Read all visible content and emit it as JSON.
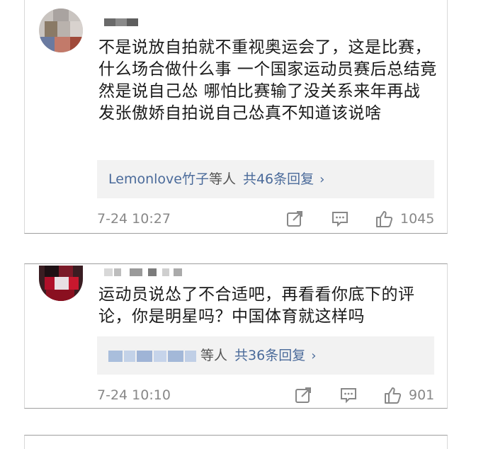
{
  "colors": {
    "link": "#4a6a9a",
    "meta_gray": "#888888",
    "reply_bg": "#f2f2f2",
    "text": "#1a1a1a"
  },
  "comments": [
    {
      "text": "不是说放自拍就不重视奥运会了，这是比赛，什么场合做什么事 一个国家运动员赛后总结竟然是说自己怂 哪怕比赛输了没关系来年再战 发张傲娇自拍说自己怂真不知道该说啥",
      "reply_names": "Lemonlove竹子",
      "reply_by": "等人",
      "reply_count": "共46条回复",
      "reply_chevron": "›",
      "time": "7-24 10:27",
      "likes": "1045",
      "icons": [
        "share-icon",
        "comment-icon",
        "like-icon"
      ]
    },
    {
      "text": "运动员说怂了不合适吧，再看看你底下的评论，你是明星吗？中国体育就这样吗",
      "reply_by": "等人",
      "reply_count": "共36条回复",
      "reply_chevron": "›",
      "time": "7-24 10:10",
      "likes": "901",
      "icons": [
        "share-icon",
        "comment-icon",
        "like-icon"
      ]
    }
  ]
}
